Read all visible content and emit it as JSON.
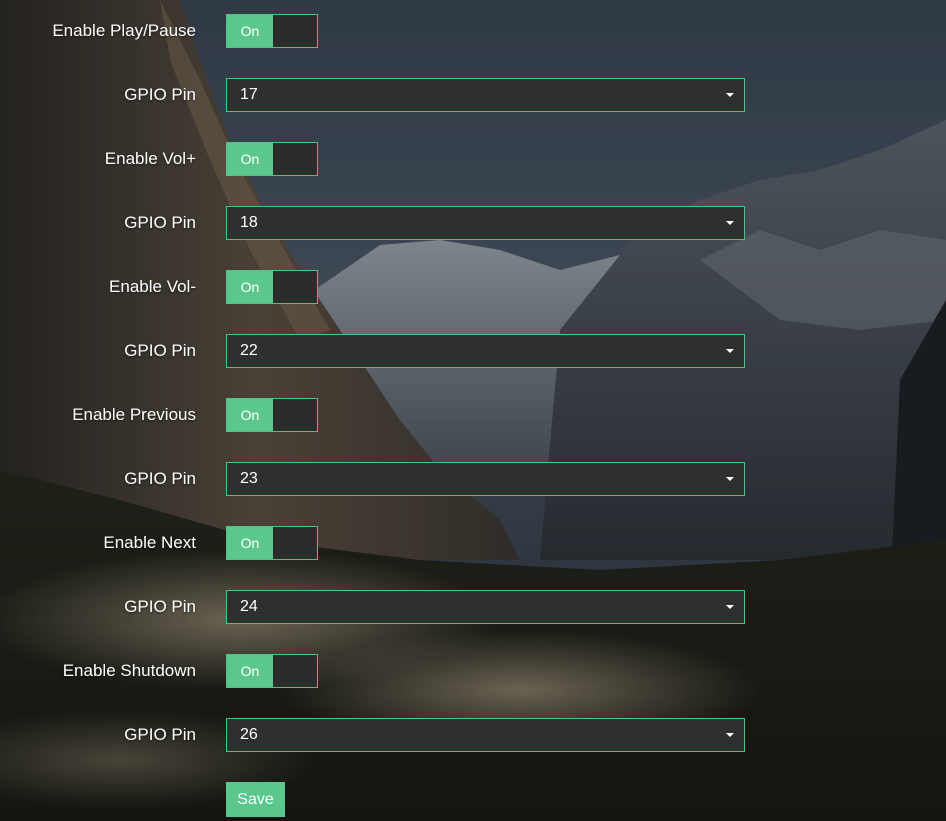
{
  "toggle_state_label": "On",
  "rows": [
    {
      "enable_label": "Enable Play/Pause",
      "enabled": true,
      "pin_label": "GPIO Pin",
      "pin_value": "17"
    },
    {
      "enable_label": "Enable Vol+",
      "enabled": true,
      "pin_label": "GPIO Pin",
      "pin_value": "18"
    },
    {
      "enable_label": "Enable Vol-",
      "enabled": true,
      "pin_label": "GPIO Pin",
      "pin_value": "22"
    },
    {
      "enable_label": "Enable Previous",
      "enabled": true,
      "pin_label": "GPIO Pin",
      "pin_value": "23"
    },
    {
      "enable_label": "Enable Next",
      "enabled": true,
      "pin_label": "GPIO Pin",
      "pin_value": "24"
    },
    {
      "enable_label": "Enable Shutdown",
      "enabled": true,
      "pin_label": "GPIO Pin",
      "pin_value": "26"
    }
  ],
  "save_label": "Save",
  "colors": {
    "accent": "#5ac78c",
    "border": "#4fc28a",
    "field_bg": "#2f2f2f"
  },
  "icons": {
    "select_caret": "chevron-down-icon"
  }
}
